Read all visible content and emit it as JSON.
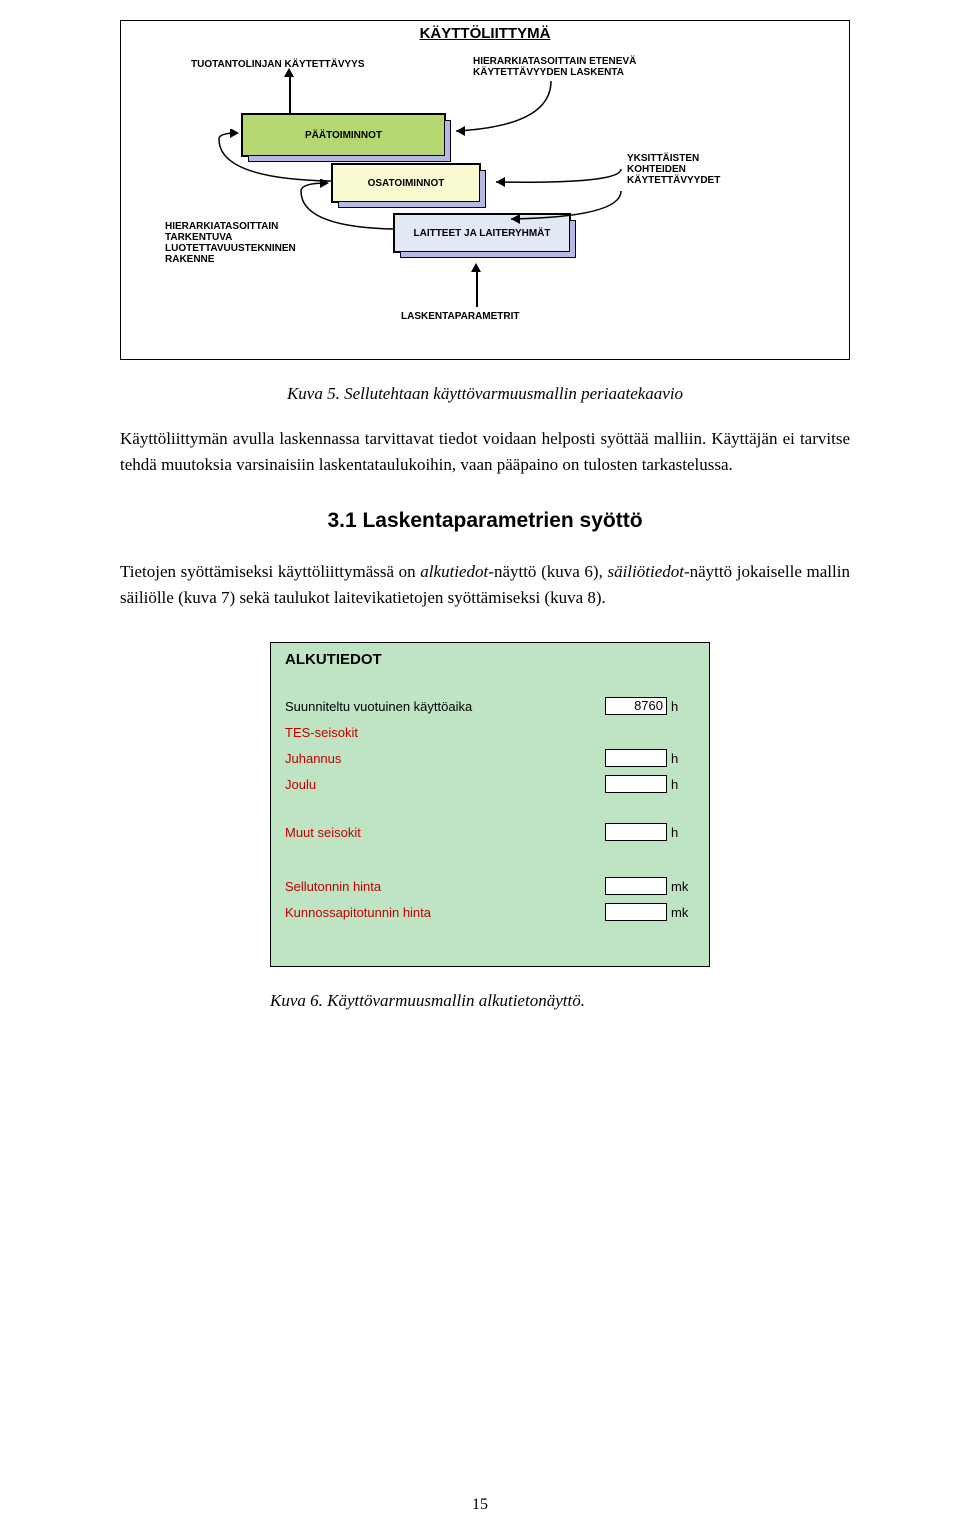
{
  "diagram": {
    "title": "KÄYTTÖLIITTYMÄ",
    "top_left_label": "TUOTANTOLINJAN KÄYTETTÄVYYS",
    "top_right_label": "HIERARKIATASOITTAIN ETENEVÄ KÄYTETTÄVYYDEN LASKENTA",
    "box_paatoiminnot": "PÄÄTOIMINNOT",
    "box_osatoiminnot": "OSATOIMINNOT",
    "box_laitteet": "LAITTEET JA LAITERYHMÄT",
    "side_right_label": "YKSITTÄISTEN KOHTEIDEN KÄYTETTÄVYYDET",
    "side_left_label": "HIERARKIATASOITTAIN TARKENTUVA LUOTETTAVUUSTEKNINEN RAKENNE",
    "bottom_label": "LASKENTAPARAMETRIT"
  },
  "caption1": "Kuva 5. Sellutehtaan käyttövarmuusmallin periaatekaavio",
  "chart_data": {
    "type": "diagram",
    "title": "KÄYTTÖLIITTYMÄ",
    "nodes": [
      "PÄÄTOIMINNOT",
      "OSATOIMINNOT",
      "LAITTEET JA LAITERYHMÄT"
    ],
    "flows": [
      {
        "from": "PÄÄTOIMINNOT",
        "to": "TUOTANTOLINJAN KÄYTETTÄVYYS",
        "note": "HIERARKIATASOITTAIN ETENEVÄ KÄYTETTÄVYYDEN LASKENTA"
      },
      {
        "from": "OSATOIMINNOT",
        "to": "PÄÄTOIMINNOT"
      },
      {
        "from": "LAITTEET JA LAITERYHMÄT",
        "to": "OSATOIMINNOT",
        "note": "YKSITTÄISTEN KOHTEIDEN KÄYTETTÄVYYDET"
      },
      {
        "from": "LASKENTAPARAMETRIT",
        "to": "LAITTEET JA LAITERYHMÄT"
      }
    ],
    "side_note_left": "HIERARKIATASOITTAIN TARKENTUVA LUOTETTAVUUSTEKNINEN RAKENNE"
  },
  "para1": "Käyttöliittymän avulla laskennassa tarvittavat tiedot voidaan helposti syöttää malliin. Käyttäjän ei tarvitse tehdä muutoksia varsinaisiin laskentataulukoihin, vaan pääpaino on tulosten tarkastelussa.",
  "heading": "3.1  Laskentaparametrien syöttö",
  "para2_a": "Tietojen syöttämiseksi käyttöliittymässä on ",
  "para2_b": "alkutiedot",
  "para2_c": "-näyttö (kuva 6), ",
  "para2_d": "säiliötiedot",
  "para2_e": "-näyttö jokaiselle mallin säiliölle (kuva 7) sekä taulukot laitevikatietojen syöttämiseksi (kuva 8).",
  "form": {
    "title": "ALKUTIEDOT",
    "row1_label": "Suunniteltu vuotuinen käyttöaika",
    "row1_value": "8760",
    "row1_unit": "h",
    "row2_label": "TES-seisokit",
    "row3_label": "Juhannus",
    "row3_unit": "h",
    "row4_label": "Joulu",
    "row4_unit": "h",
    "row5_label": "Muut seisokit",
    "row5_unit": "h",
    "row6_label": "Sellutonnin hinta",
    "row6_unit": "mk",
    "row7_label": "Kunnossapitotunnin hinta",
    "row7_unit": "mk"
  },
  "caption2": "Kuva 6. Käyttövarmuusmallin alkutietonäyttö.",
  "page_number": "15"
}
